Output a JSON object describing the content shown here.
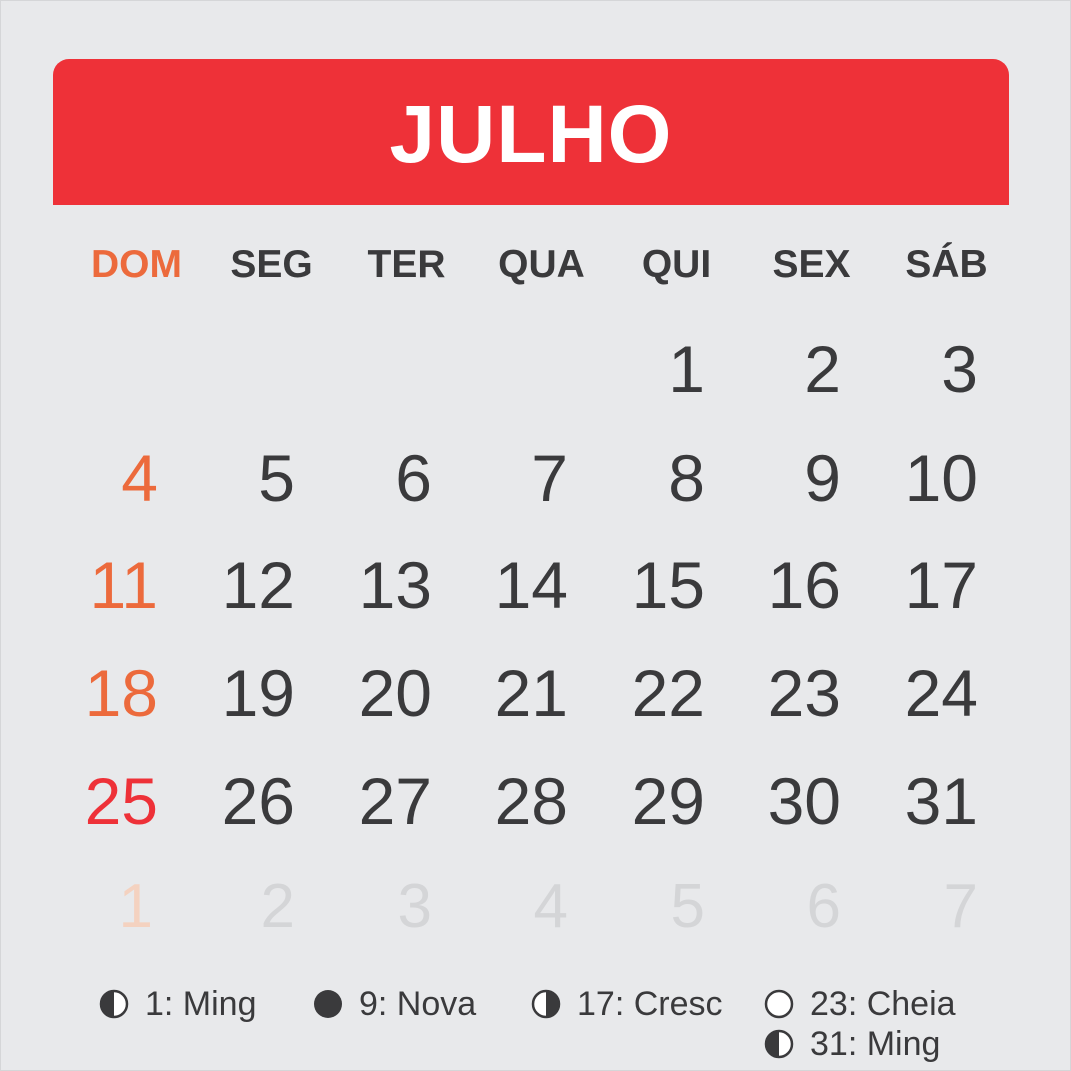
{
  "month": "JULHO",
  "weekdays": [
    "DOM",
    "SEG",
    "TER",
    "QUA",
    "QUI",
    "SEX",
    "SÁB"
  ],
  "weeks": [
    [
      "",
      "",
      "",
      "",
      "1",
      "2",
      "3"
    ],
    [
      "4",
      "5",
      "6",
      "7",
      "8",
      "9",
      "10"
    ],
    [
      "11",
      "12",
      "13",
      "14",
      "15",
      "16",
      "17"
    ],
    [
      "18",
      "19",
      "20",
      "21",
      "22",
      "23",
      "24"
    ],
    [
      "25",
      "26",
      "27",
      "28",
      "29",
      "30",
      "31"
    ]
  ],
  "next_month_days": [
    "1",
    "2",
    "3",
    "4",
    "5",
    "6",
    "7"
  ],
  "moon_phases": [
    {
      "label": "1: Ming",
      "icon": "waning-moon-icon"
    },
    {
      "label": "9: Nova",
      "icon": "new-moon-icon"
    },
    {
      "label": "17: Cresc",
      "icon": "waxing-moon-icon"
    },
    {
      "label": "23: Cheia",
      "icon": "full-moon-icon"
    },
    {
      "label": "31: Ming",
      "icon": "waning-moon-icon"
    }
  ],
  "colors": {
    "header": "#ee3138",
    "background": "#e8e9eb",
    "text": "#3a3a3c",
    "sunday": "#ec6a3c",
    "sunday_highlight": "#ee3138",
    "next_month": "#d4d5d7"
  }
}
